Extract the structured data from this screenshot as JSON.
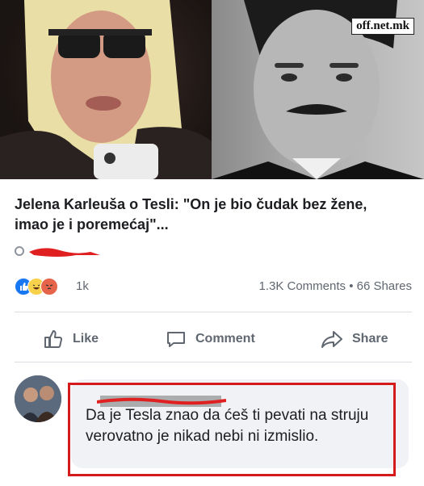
{
  "image": {
    "watermark": "off.net.mk"
  },
  "post": {
    "headline": "Jelena Karleuša o Tesli: \"On je bio čudak bez žene, imao je i poremećaj\"...",
    "reaction_count": "1k",
    "comments_shares": "1.3K Comments • 66 Shares",
    "reactions": [
      "like-icon",
      "haha-icon",
      "angry-icon"
    ]
  },
  "actions": {
    "like_label": "Like",
    "comment_label": "Comment",
    "share_label": "Share"
  },
  "comment": {
    "text": "Da je Tesla znao da ćeš ti pevati na struju verovatno je nikad nebi ni izmislio."
  },
  "colors": {
    "annotation_red": "#d41a1a",
    "facebook_blue": "#1877f2",
    "text_gray": "#606770"
  }
}
